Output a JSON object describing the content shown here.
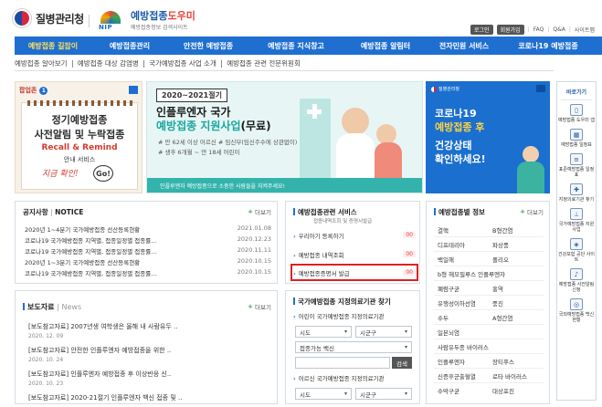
{
  "header": {
    "kdca_name": "질병관리청",
    "nip_badge": "NIP",
    "nip_title_a": "예방접종",
    "nip_title_b": "도우미",
    "nip_subtitle": "예방접종정보 검색사이트",
    "util": {
      "login": "로그인",
      "join": "회원가입",
      "faq": "FAQ",
      "qa": "Q&A",
      "sitemap": "사이트맵",
      "sep": "|"
    }
  },
  "gnb": [
    "예방접종 길잡이",
    "예방접종관리",
    "안전한 예방접종",
    "예방접종 지식창고",
    "예방접종 알림터",
    "전자민원 서비스",
    "코로나19 예방접종"
  ],
  "subnav": [
    "예방접종 알아보기",
    "예방접종 대상 감염병",
    "국가예방접종 사업 소개",
    "예방접종 관련 전문위원회"
  ],
  "subnav_sep": "|",
  "popup": {
    "label": "팝업존",
    "count": "1",
    "line1": "정기예방접종",
    "line2": "사전알림 및 누락접종",
    "line3": "Recall & Remind",
    "line4": "안내 서비스",
    "line5": "지금 확인!",
    "go": "Go!"
  },
  "banner_flu": {
    "year": "2020~2021절기",
    "title1": "인플루엔자 국가",
    "title2a": "예방접종 지원사업",
    "title2b": "(무료)",
    "line1": "# 만 62세 이상 어르신 # 임신부(임신주수에 상관없이)",
    "line2": "# 생후 6개월 ~ 만 18세 어린이",
    "footer": "인플루엔자 예방접종으로 소중한 사람들을 지켜주세요!"
  },
  "banner_covid": {
    "logo": "질병관리청",
    "title1": "코로나19",
    "title2": "예방접종 후",
    "title3": "건강상태",
    "title4": "확인하세요!"
  },
  "quick": {
    "title": "바로가기",
    "items": [
      "예방접종 도우미 앱",
      "예방접종 일정표",
      "표준예방접종 일정표",
      "지정의료기관 찾기",
      "국가예방접종 지원사업",
      "건강보험 공단 사이트",
      "예방접종 사전알림 신청",
      "국외예방접종 백신현황"
    ]
  },
  "notice": {
    "title": "공지사항",
    "title_en": "NOTICE",
    "more": "더보기",
    "items": [
      {
        "text": "2020년 1~4분기 국가예방접종 선산등록현황",
        "date": "2021.01.08"
      },
      {
        "text": "코로나19 국가예방접종 지역별, 접종일정별 접종률...",
        "date": "2020.12.23"
      },
      {
        "text": "코로나19 국가예방접종 지역별, 접종일정별 접종률...",
        "date": "2020.11.11"
      },
      {
        "text": "2020년 1~3분기 국가예방접종 선산등록현황",
        "date": "2020.10.15"
      },
      {
        "text": "코로나19 국가예방접종 지역별, 접종일정별 접종률...",
        "date": "2020.10.15"
      }
    ]
  },
  "press": {
    "title": "보도자료",
    "title_en": "News",
    "more": "더보기",
    "items": [
      {
        "text": "[보도참고자료] 2007년생 여학생은 올해 내 사람유두 ..",
        "date": "2020. 12. 09"
      },
      {
        "text": "[보도참고자료] 안전한 인플루엔자 예방접종을 위한 ..",
        "date": "2020. 10. 24"
      },
      {
        "text": "[보도참고자료] 인플루엔자 예방접종 후 이상반응 신..",
        "date": "2020. 10. 23"
      },
      {
        "text": "[보도참고자료] 2020-21절기 인플루엔자 백신 접종 및 ..",
        "date": ""
      }
    ]
  },
  "services": {
    "title": "예방접종관련 서비스",
    "sub": "접종내역조회 및 증명서발급",
    "items": [
      {
        "label": "우리아기 등록하기",
        "count": "00"
      },
      {
        "label": "예방접종 내역조회",
        "count": "00"
      },
      {
        "label": "예방접종증명서 발급",
        "count": "00"
      }
    ]
  },
  "clinic": {
    "title": "국가예방접종 지정의료기관 찾기",
    "child_label": "어린이 국가예방접종 지정의료기관",
    "sido": "시도",
    "sigungu": "시군구",
    "vaccine": "접종가능 백신",
    "search": "검색",
    "flu_label": "어르신 국가예방접종 지정의료기관"
  },
  "disease": {
    "title": "예방접종별 정보",
    "more": "더보기",
    "items": [
      "결핵",
      "B형간염",
      "디프테리아",
      "파상풍",
      "백일해",
      "폴리오",
      "b형 헤모필루스 인플루엔자",
      "폐렴구균",
      "홍역",
      "유행성이하선염",
      "풍진",
      "수두",
      "A형간염",
      "일본뇌염",
      "사람유두종 바이러스",
      "인플루엔자",
      "장티푸스",
      "신증후군출혈열",
      "로타 바이러스",
      "수막구균",
      "대상포진"
    ]
  }
}
